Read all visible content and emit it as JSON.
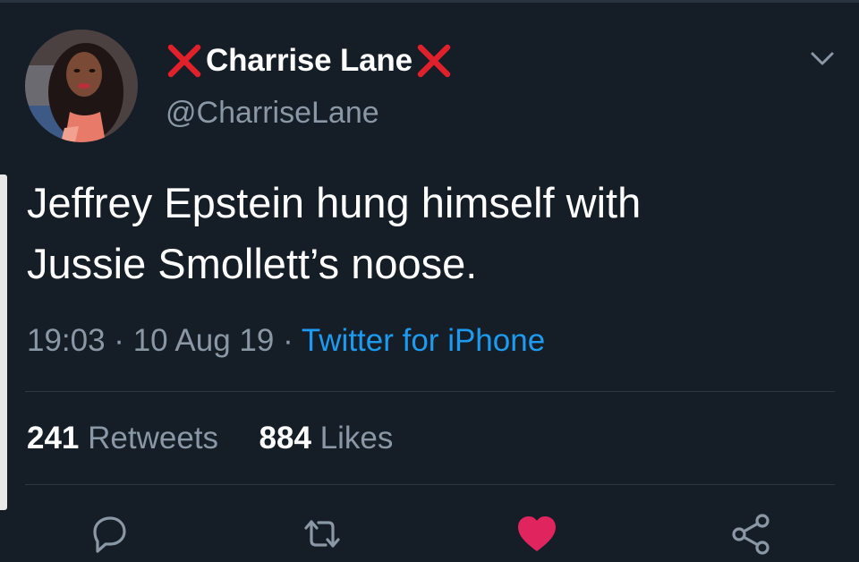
{
  "tweet": {
    "author": {
      "display_name": "Charrise Lane",
      "handle": "@CharriseLane",
      "name_decoration_icon": "red-cross-mark-emoji"
    },
    "text_line1": "Jeffrey Epstein hung himself with",
    "text_line2": "Jussie Smollett’s noose.",
    "timestamp": "19:03 · 10 Aug 19 · ",
    "source": "Twitter for iPhone",
    "stats": {
      "retweets_count": "241",
      "retweets_label": "Retweets",
      "likes_count": "884",
      "likes_label": "Likes"
    },
    "actions": {
      "reply_icon": "reply-bubble-icon",
      "retweet_icon": "retweet-arrows-icon",
      "like_icon": "heart-icon",
      "like_active": true,
      "share_icon": "share-icon"
    }
  },
  "colors": {
    "background": "#151d27",
    "text_primary": "#ffffff",
    "text_secondary": "#8a97a4",
    "link": "#1d9bf0",
    "like_active": "#e0245e",
    "cross_mark": "#e0202b"
  }
}
